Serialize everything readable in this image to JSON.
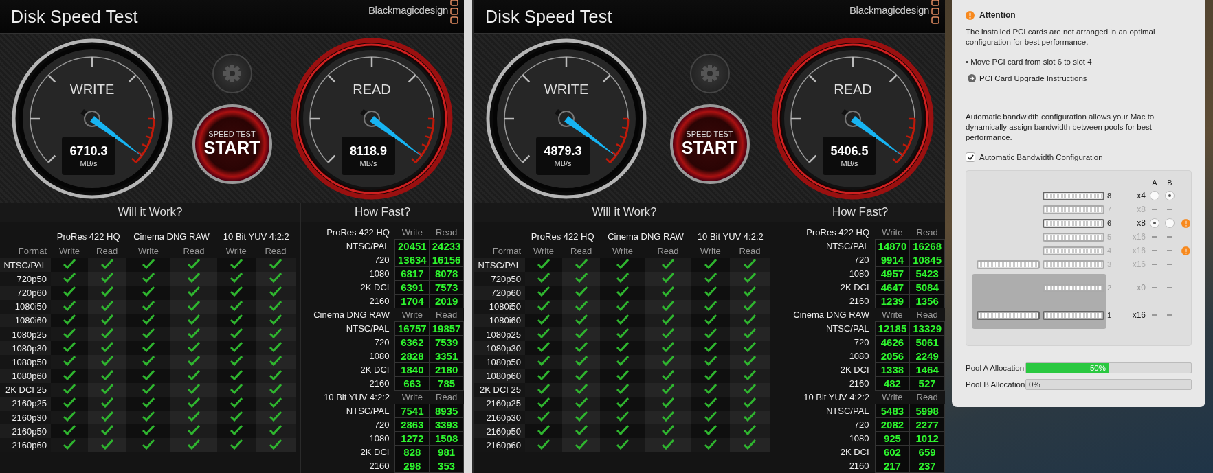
{
  "windows": [
    {
      "title": "Disk Speed Test",
      "brand": "Blackmagicdesign",
      "gauges": [
        {
          "kind": "write",
          "label": "WRITE",
          "value": "6710.3",
          "unit": "MB/s"
        },
        {
          "kind": "read",
          "label": "READ",
          "value": "8118.9",
          "unit": "MB/s"
        }
      ],
      "start_button": {
        "caption": "SPEED TEST",
        "label": "START"
      },
      "will_it_work": {
        "title": "Will it Work?",
        "codecs": [
          "ProRes 422 HQ",
          "Cinema DNG RAW",
          "10 Bit YUV 4:2:2"
        ],
        "format_header": "Format",
        "column_labels": [
          "Write",
          "Read",
          "Write",
          "Read",
          "Write",
          "Read"
        ],
        "rows": [
          {
            "format": "NTSC/PAL",
            "ok": [
              true,
              true,
              true,
              true,
              true,
              true
            ]
          },
          {
            "format": "720p50",
            "ok": [
              true,
              true,
              true,
              true,
              true,
              true
            ]
          },
          {
            "format": "720p60",
            "ok": [
              true,
              true,
              true,
              true,
              true,
              true
            ]
          },
          {
            "format": "1080i50",
            "ok": [
              true,
              true,
              true,
              true,
              true,
              true
            ]
          },
          {
            "format": "1080i60",
            "ok": [
              true,
              true,
              true,
              true,
              true,
              true
            ]
          },
          {
            "format": "1080p25",
            "ok": [
              true,
              true,
              true,
              true,
              true,
              true
            ]
          },
          {
            "format": "1080p30",
            "ok": [
              true,
              true,
              true,
              true,
              true,
              true
            ]
          },
          {
            "format": "1080p50",
            "ok": [
              true,
              true,
              true,
              true,
              true,
              true
            ]
          },
          {
            "format": "1080p60",
            "ok": [
              true,
              true,
              true,
              true,
              true,
              true
            ]
          },
          {
            "format": "2K DCI 25",
            "ok": [
              true,
              true,
              true,
              true,
              true,
              true
            ]
          },
          {
            "format": "2160p25",
            "ok": [
              true,
              true,
              true,
              true,
              true,
              true
            ]
          },
          {
            "format": "2160p30",
            "ok": [
              true,
              true,
              true,
              true,
              true,
              true
            ]
          },
          {
            "format": "2160p50",
            "ok": [
              true,
              true,
              true,
              true,
              true,
              true
            ]
          },
          {
            "format": "2160p60",
            "ok": [
              true,
              true,
              true,
              true,
              true,
              true
            ]
          }
        ]
      },
      "how_fast": {
        "title": "How Fast?",
        "groups": [
          {
            "codec": "ProRes 422 HQ",
            "write_header": "Write",
            "read_header": "Read",
            "rows": [
              {
                "format": "NTSC/PAL",
                "write": "20451",
                "read": "24233"
              },
              {
                "format": "720",
                "write": "13634",
                "read": "16156"
              },
              {
                "format": "1080",
                "write": "6817",
                "read": "8078"
              },
              {
                "format": "2K DCI",
                "write": "6391",
                "read": "7573"
              },
              {
                "format": "2160",
                "write": "1704",
                "read": "2019"
              }
            ]
          },
          {
            "codec": "Cinema DNG RAW",
            "write_header": "Write",
            "read_header": "Read",
            "rows": [
              {
                "format": "NTSC/PAL",
                "write": "16757",
                "read": "19857"
              },
              {
                "format": "720",
                "write": "6362",
                "read": "7539"
              },
              {
                "format": "1080",
                "write": "2828",
                "read": "3351"
              },
              {
                "format": "2K DCI",
                "write": "1840",
                "read": "2180"
              },
              {
                "format": "2160",
                "write": "663",
                "read": "785"
              }
            ]
          },
          {
            "codec": "10 Bit YUV 4:2:2",
            "write_header": "Write",
            "read_header": "Read",
            "rows": [
              {
                "format": "NTSC/PAL",
                "write": "7541",
                "read": "8935"
              },
              {
                "format": "720",
                "write": "2863",
                "read": "3393"
              },
              {
                "format": "1080",
                "write": "1272",
                "read": "1508"
              },
              {
                "format": "2K DCI",
                "write": "828",
                "read": "981"
              },
              {
                "format": "2160",
                "write": "298",
                "read": "353"
              }
            ]
          }
        ]
      }
    },
    {
      "title": "Disk Speed Test",
      "brand": "Blackmagicdesign",
      "gauges": [
        {
          "kind": "write",
          "label": "WRITE",
          "value": "4879.3",
          "unit": "MB/s"
        },
        {
          "kind": "read",
          "label": "READ",
          "value": "5406.5",
          "unit": "MB/s"
        }
      ],
      "start_button": {
        "caption": "SPEED TEST",
        "label": "START"
      },
      "will_it_work": {
        "title": "Will it Work?",
        "codecs": [
          "ProRes 422 HQ",
          "Cinema DNG RAW",
          "10 Bit YUV 4:2:2"
        ],
        "format_header": "Format",
        "column_labels": [
          "Write",
          "Read",
          "Write",
          "Read",
          "Write",
          "Read"
        ],
        "rows": [
          {
            "format": "NTSC/PAL",
            "ok": [
              true,
              true,
              true,
              true,
              true,
              true
            ]
          },
          {
            "format": "720p50",
            "ok": [
              true,
              true,
              true,
              true,
              true,
              true
            ]
          },
          {
            "format": "720p60",
            "ok": [
              true,
              true,
              true,
              true,
              true,
              true
            ]
          },
          {
            "format": "1080i50",
            "ok": [
              true,
              true,
              true,
              true,
              true,
              true
            ]
          },
          {
            "format": "1080i60",
            "ok": [
              true,
              true,
              true,
              true,
              true,
              true
            ]
          },
          {
            "format": "1080p25",
            "ok": [
              true,
              true,
              true,
              true,
              true,
              true
            ]
          },
          {
            "format": "1080p30",
            "ok": [
              true,
              true,
              true,
              true,
              true,
              true
            ]
          },
          {
            "format": "1080p50",
            "ok": [
              true,
              true,
              true,
              true,
              true,
              true
            ]
          },
          {
            "format": "1080p60",
            "ok": [
              true,
              true,
              true,
              true,
              true,
              true
            ]
          },
          {
            "format": "2K DCI 25",
            "ok": [
              true,
              true,
              true,
              true,
              true,
              true
            ]
          },
          {
            "format": "2160p25",
            "ok": [
              true,
              true,
              true,
              true,
              true,
              true
            ]
          },
          {
            "format": "2160p30",
            "ok": [
              true,
              true,
              true,
              true,
              true,
              true
            ]
          },
          {
            "format": "2160p50",
            "ok": [
              true,
              true,
              true,
              true,
              true,
              true
            ]
          },
          {
            "format": "2160p60",
            "ok": [
              true,
              true,
              true,
              true,
              true,
              true
            ]
          }
        ]
      },
      "how_fast": {
        "title": "How Fast?",
        "groups": [
          {
            "codec": "ProRes 422 HQ",
            "write_header": "Write",
            "read_header": "Read",
            "rows": [
              {
                "format": "NTSC/PAL",
                "write": "14870",
                "read": "16268"
              },
              {
                "format": "720",
                "write": "9914",
                "read": "10845"
              },
              {
                "format": "1080",
                "write": "4957",
                "read": "5423"
              },
              {
                "format": "2K DCI",
                "write": "4647",
                "read": "5084"
              },
              {
                "format": "2160",
                "write": "1239",
                "read": "1356"
              }
            ]
          },
          {
            "codec": "Cinema DNG RAW",
            "write_header": "Write",
            "read_header": "Read",
            "rows": [
              {
                "format": "NTSC/PAL",
                "write": "12185",
                "read": "13329"
              },
              {
                "format": "720",
                "write": "4626",
                "read": "5061"
              },
              {
                "format": "1080",
                "write": "2056",
                "read": "2249"
              },
              {
                "format": "2K DCI",
                "write": "1338",
                "read": "1464"
              },
              {
                "format": "2160",
                "write": "482",
                "read": "527"
              }
            ]
          },
          {
            "codec": "10 Bit YUV 4:2:2",
            "write_header": "Write",
            "read_header": "Read",
            "rows": [
              {
                "format": "NTSC/PAL",
                "write": "5483",
                "read": "5998"
              },
              {
                "format": "720",
                "write": "2082",
                "read": "2277"
              },
              {
                "format": "1080",
                "write": "925",
                "read": "1012"
              },
              {
                "format": "2K DCI",
                "write": "602",
                "read": "659"
              },
              {
                "format": "2160",
                "write": "217",
                "read": "237"
              }
            ]
          }
        ]
      }
    }
  ],
  "pci_panel": {
    "attention": {
      "title": "Attention",
      "message": "The installed PCI cards are not arranged in an optimal configuration for best performance.",
      "bullet": "• Move PCI card from slot 6 to slot 4",
      "link": "PCI Card Upgrade Instructions"
    },
    "description": "Automatic bandwidth configuration allows your Mac to dynamically assign bandwidth between pools for best performance.",
    "auto_config": {
      "label": "Automatic Bandwidth Configuration",
      "checked": true
    },
    "slot_map": {
      "pool_headers": [
        "A",
        "B"
      ],
      "slots": [
        {
          "number": "8",
          "lanes": "x4",
          "occupied": true,
          "wide": false,
          "warning": false,
          "pools": [
            {
              "kind": "radio",
              "selected": false
            },
            {
              "kind": "radio",
              "selected": true
            }
          ]
        },
        {
          "number": "7",
          "lanes": "x8",
          "occupied": false,
          "wide": false,
          "warning": false,
          "pools": [
            {
              "kind": "none"
            },
            {
              "kind": "none"
            }
          ]
        },
        {
          "number": "6",
          "lanes": "x8",
          "occupied": true,
          "wide": false,
          "warning": true,
          "pools": [
            {
              "kind": "radio",
              "selected": true
            },
            {
              "kind": "radio",
              "selected": false
            }
          ]
        },
        {
          "number": "5",
          "lanes": "x16",
          "occupied": false,
          "wide": false,
          "warning": false,
          "pools": [
            {
              "kind": "none"
            },
            {
              "kind": "none"
            }
          ]
        },
        {
          "number": "4",
          "lanes": "x16",
          "occupied": false,
          "wide": false,
          "warning": true,
          "pools": [
            {
              "kind": "none"
            },
            {
              "kind": "none"
            }
          ]
        },
        {
          "number": "3",
          "lanes": "x16",
          "occupied": false,
          "wide": true,
          "warning": false,
          "pools": [
            {
              "kind": "none"
            },
            {
              "kind": "none"
            }
          ]
        }
      ],
      "module_slots": [
        {
          "number": "2",
          "lanes": "x0",
          "occupied": false,
          "wide": false,
          "warning": false,
          "pools": [
            {
              "kind": "none"
            },
            {
              "kind": "none"
            }
          ]
        },
        {
          "number": "1",
          "lanes": "x16",
          "occupied": true,
          "wide": true,
          "warning": false,
          "pools": [
            {
              "kind": "none"
            },
            {
              "kind": "none"
            }
          ]
        }
      ]
    },
    "pools": [
      {
        "label": "Pool A Allocation",
        "level": 0.5,
        "reading": "50%"
      },
      {
        "label": "Pool B Allocation",
        "level": 0,
        "reading": "0%"
      }
    ]
  }
}
